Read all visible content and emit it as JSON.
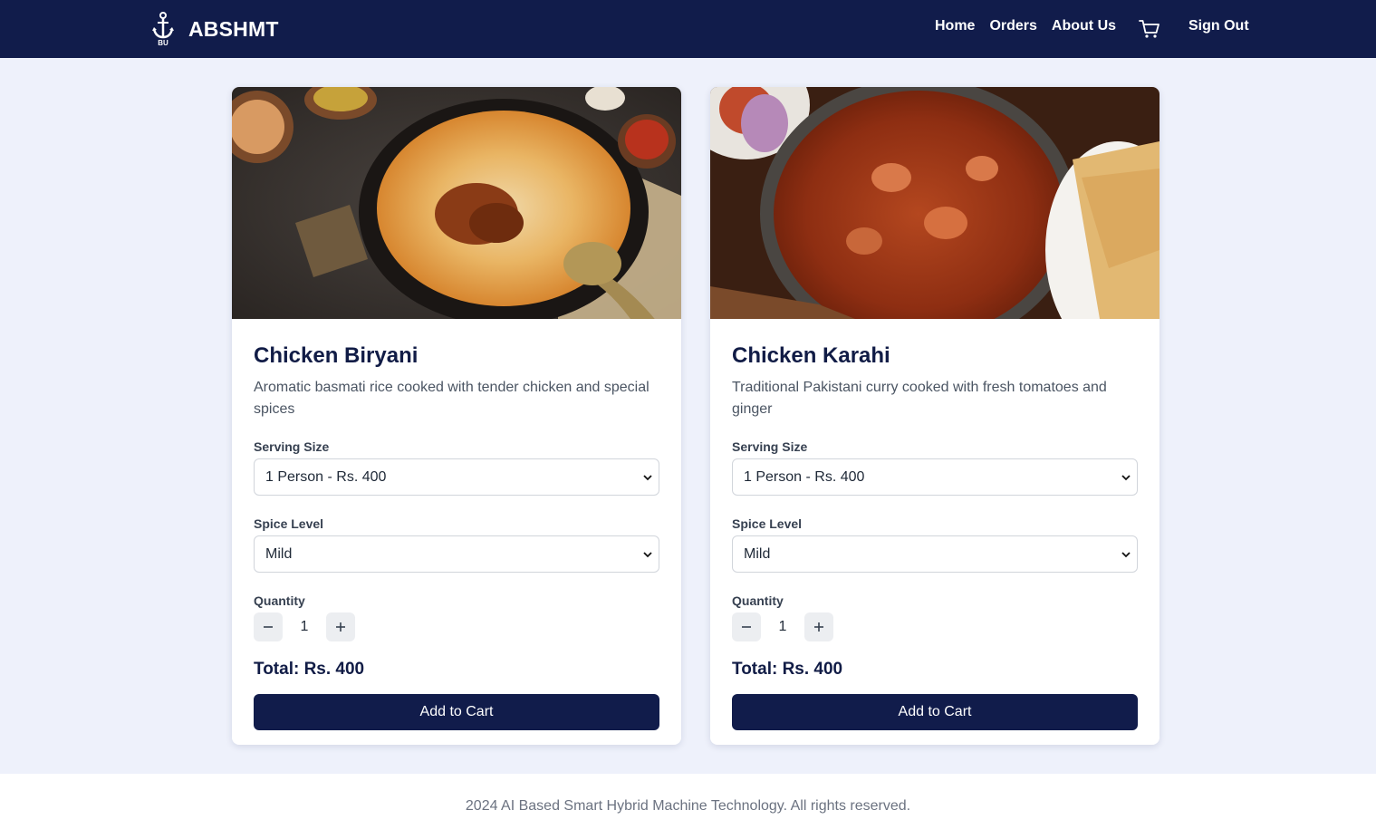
{
  "header": {
    "brand": "ABSHMT",
    "logo_text": "BU",
    "nav": [
      "Home",
      "Orders",
      "About Us"
    ],
    "cart_icon": "shopping-cart-icon",
    "sign_out": "Sign Out"
  },
  "products": [
    {
      "name": "Chicken Biryani",
      "description": "Aromatic basmati rice cooked with tender chicken and special spices",
      "serving_label": "Serving Size",
      "serving_value": "1 Person - Rs. 400",
      "spice_label": "Spice Level",
      "spice_value": "Mild",
      "quantity_label": "Quantity",
      "quantity": "1",
      "total": "Total: Rs. 400",
      "button": "Add to Cart"
    },
    {
      "name": "Chicken Karahi",
      "description": "Traditional Pakistani curry cooked with fresh tomatoes and ginger",
      "serving_label": "Serving Size",
      "serving_value": "1 Person - Rs. 400",
      "spice_label": "Spice Level",
      "spice_value": "Mild",
      "quantity_label": "Quantity",
      "quantity": "1",
      "total": "Total: Rs. 400",
      "button": "Add to Cart"
    }
  ],
  "footer": {
    "text": "2024 AI Based Smart Hybrid Machine Technology. All rights reserved."
  },
  "colors": {
    "navy": "#111c4b",
    "background": "#eef1fb"
  }
}
